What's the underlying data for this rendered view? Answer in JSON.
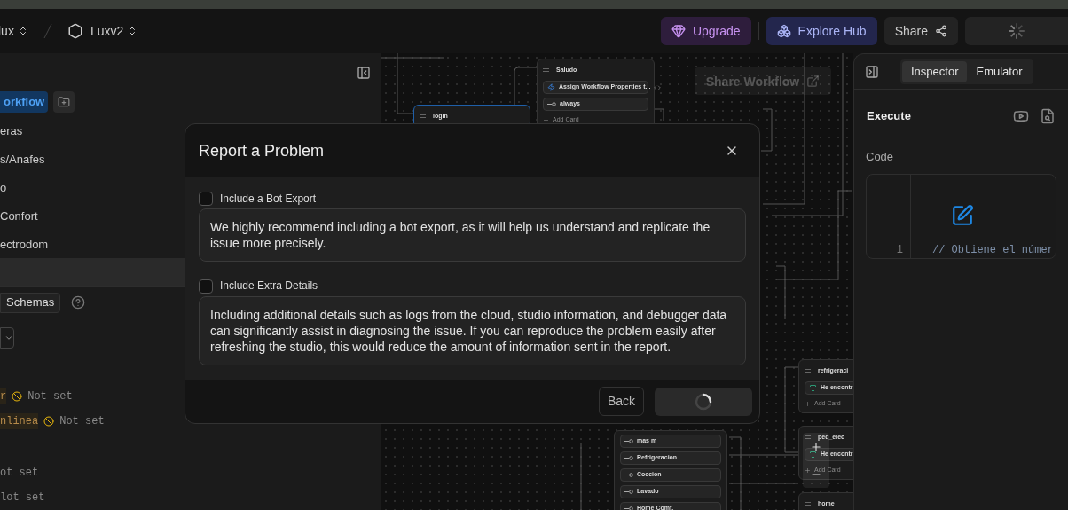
{
  "top_bar": {
    "workspace": "lux",
    "project": "Luxv2",
    "buttons": [
      {
        "kind": "upgrade",
        "label": "Upgrade"
      },
      {
        "kind": "hub",
        "label": "Explore Hub"
      },
      {
        "kind": "share",
        "label": "Share"
      },
      {
        "kind": "loading"
      }
    ]
  },
  "left_panel": {
    "new_button": "orkflow",
    "items": [
      {
        "label": "eras",
        "selected": false
      },
      {
        "label": "s/Anafes",
        "selected": false
      },
      {
        "label": "o",
        "selected": false
      },
      {
        "label": "Confort",
        "selected": false
      },
      {
        "label": "ectrodom",
        "selected": false
      },
      {
        "selected": true
      }
    ],
    "schemas_button": "Schemas",
    "variables": [
      {
        "kind": "unset",
        "name": "r",
        "value": "Not set"
      },
      {
        "kind": "unset",
        "name": "nlinea",
        "value": "Not set"
      },
      {
        "kind": "plain",
        "value": "ot set"
      },
      {
        "kind": "plain",
        "value": "lot set"
      }
    ]
  },
  "canvas": {
    "share_button": "Share Workflow",
    "nodes": [
      {
        "title": "login",
        "selected": true
      },
      {
        "title": "Saludo",
        "selected": false,
        "cards": [
          {
            "kind": "action",
            "text": "Assign Workflow Properties t..."
          },
          {
            "kind": "transition",
            "text": "always"
          }
        ],
        "add_label": "Add Card"
      },
      {
        "selected": false,
        "cards": [
          {
            "kind": "transition",
            "text": "mas m"
          },
          {
            "kind": "transition",
            "text": "Refrigeracion"
          },
          {
            "kind": "transition",
            "text": "Coccion"
          },
          {
            "kind": "transition",
            "text": "Lavado"
          },
          {
            "kind": "transition",
            "text": "Home Comf."
          }
        ]
      },
      {
        "title": "refrigeraci",
        "selected": false,
        "cards": [
          {
            "kind": "text",
            "text": "He encontr"
          }
        ],
        "add_label": "Add Card"
      },
      {
        "title": "peq_elec",
        "selected": false,
        "cards": [
          {
            "kind": "text",
            "text": "He encontr"
          }
        ],
        "add_label": "Add Card"
      },
      {
        "title": "home",
        "selected": false
      }
    ]
  },
  "right_panel": {
    "tabs": [
      {
        "label": "Inspector",
        "selected": true
      },
      {
        "label": "Emulator",
        "selected": false
      }
    ],
    "section_title": "Execute",
    "field_label": "Code",
    "code_lines": [
      {
        "number": "1",
        "text": "// Obtiene el númer"
      }
    ]
  },
  "modal": {
    "title": "Report a Problem",
    "options": [
      {
        "label": "Include a Bot Export",
        "checked": false,
        "description": "We highly recommend including a bot export, as it will help us understand and replicate the issue more precisely."
      },
      {
        "label": "Include Extra Details",
        "checked": false,
        "description": "Including additional details such as logs from the cloud, studio information, and debugger data can significantly assist in diagnosing the issue. If you can reproduce the problem easily after refreshing the studio, this would reduce the amount of information sent in the report."
      }
    ],
    "back_button": "Back",
    "submit_loading": true
  }
}
